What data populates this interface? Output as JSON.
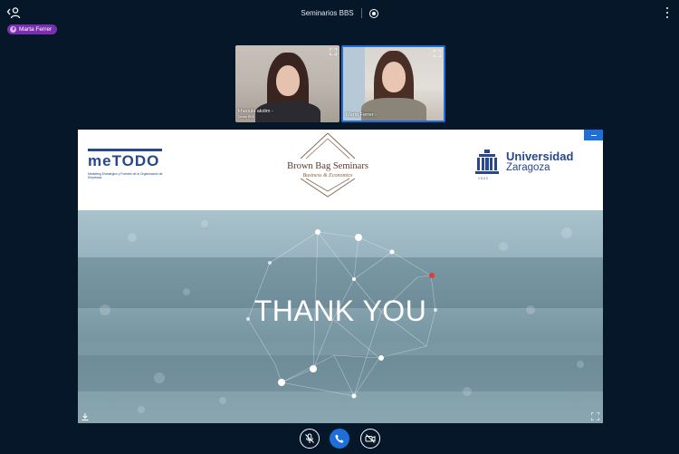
{
  "topbar": {
    "title": "Seminarios BBS",
    "users_toggle_icon": "user-list-icon",
    "record_icon": "record-icon",
    "options_icon": "more-vertical-icon"
  },
  "talking_indicator": {
    "name": "Marta Ferrer",
    "icon": "mic-icon",
    "color": "#7a2fb0"
  },
  "videos": [
    {
      "name": "khaoula akdim",
      "extra": "-",
      "subtitle": "Desde BBS"
    },
    {
      "name": "Marta Ferrer",
      "extra": "-",
      "active": true
    }
  ],
  "presentation": {
    "logo_left": {
      "word": "meTODO",
      "subtitle": "Marketing Estrategico y Fuentes de la Organización de Empresas"
    },
    "logo_center": {
      "title": "Brown Bag Seminars",
      "subtitle": "Business & Economics"
    },
    "logo_right": {
      "name": "Universidad",
      "city": "Zaragoza",
      "year": "1542"
    },
    "slide_text": "THANK YOU",
    "download_icon": "download-icon",
    "fullscreen_icon": "fullscreen-icon",
    "minimize_icon": "minimize-icon"
  },
  "action_bar": {
    "mic_icon": "mic-muted-icon",
    "phone_icon": "phone-icon",
    "camera_icon": "camera-off-icon",
    "accent": "#1f6fd8"
  }
}
